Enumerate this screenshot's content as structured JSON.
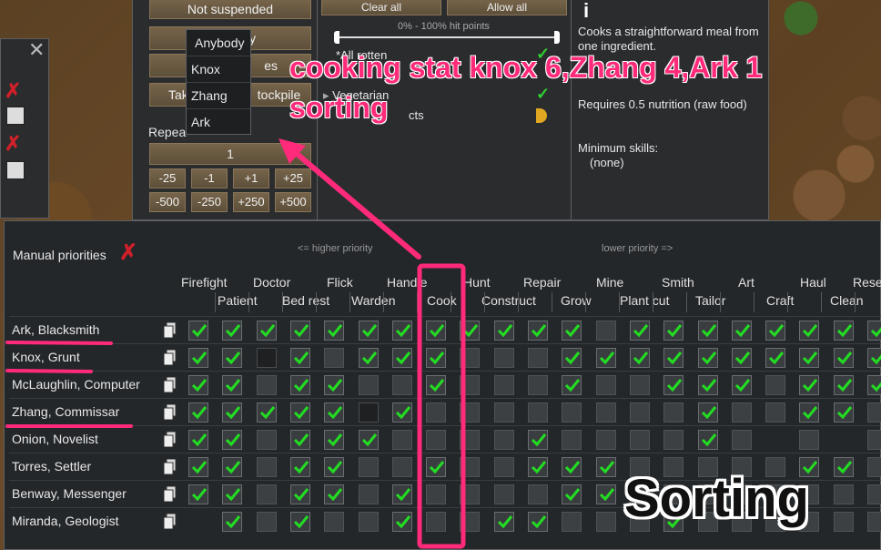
{
  "bill_panel": {
    "suspend_label": "Not suspended",
    "ingredient_radius_label": "",
    "ingredient_radius_suffix": "y",
    "zone_label_suffix": "es",
    "take_to_label_prefix": "Tak",
    "take_to_label_suffix": "tockpile",
    "repeat_label": "Repea",
    "repeat_count": "1",
    "adjust_buttons_row1": [
      "-25",
      "-1",
      "+1",
      "+25"
    ],
    "adjust_buttons_row2": [
      "-500",
      "-250",
      "+250",
      "+500"
    ],
    "dropdown_options": [
      "Anybody",
      "Knox",
      "Zhang",
      "Ark"
    ]
  },
  "filter_panel": {
    "clear_all": "Clear all",
    "allow_all": "Allow all",
    "hit_points_label": "0% - 100% hit points",
    "items": [
      "*All rotten",
      "Vegetarian",
      "cts"
    ]
  },
  "info_panel": {
    "description": "Cooks a straightforward meal from one ingredient.",
    "nutrition": "Requires 0.5 nutrition (raw food)",
    "min_skills_label": "Minimum skills:",
    "min_skills_value": "(none)"
  },
  "left_panel": {},
  "work_tab": {
    "manual_priorities": "Manual priorities",
    "higher_priority": "<= higher priority",
    "lower_priority": "lower priority =>",
    "columns_top": [
      "Firefight",
      "Doctor",
      "Flick",
      "Handle",
      "Hunt",
      "Repair",
      "Mine",
      "Smith",
      "Art",
      "Haul",
      "Rese"
    ],
    "columns_bottom": [
      "Patient",
      "Bed rest",
      "Warden",
      "Cook",
      "Construct",
      "Grow",
      "Plant cut",
      "Tailor",
      "Craft",
      "Clean"
    ],
    "pawns": [
      "Ark, Blacksmith",
      "Knox, Grunt",
      "McLaughlin, Computer",
      "Zhang, Commissar",
      "Onion, Novelist",
      "Torres, Settler",
      "Benway, Messenger",
      "Miranda, Geologist"
    ]
  },
  "annotations": {
    "title_line1": "cooking stat knox 6,Zhang 4,Ark 1",
    "title_line2": "sorting",
    "big_label": "Sorting",
    "color": "#ff2a7a"
  }
}
